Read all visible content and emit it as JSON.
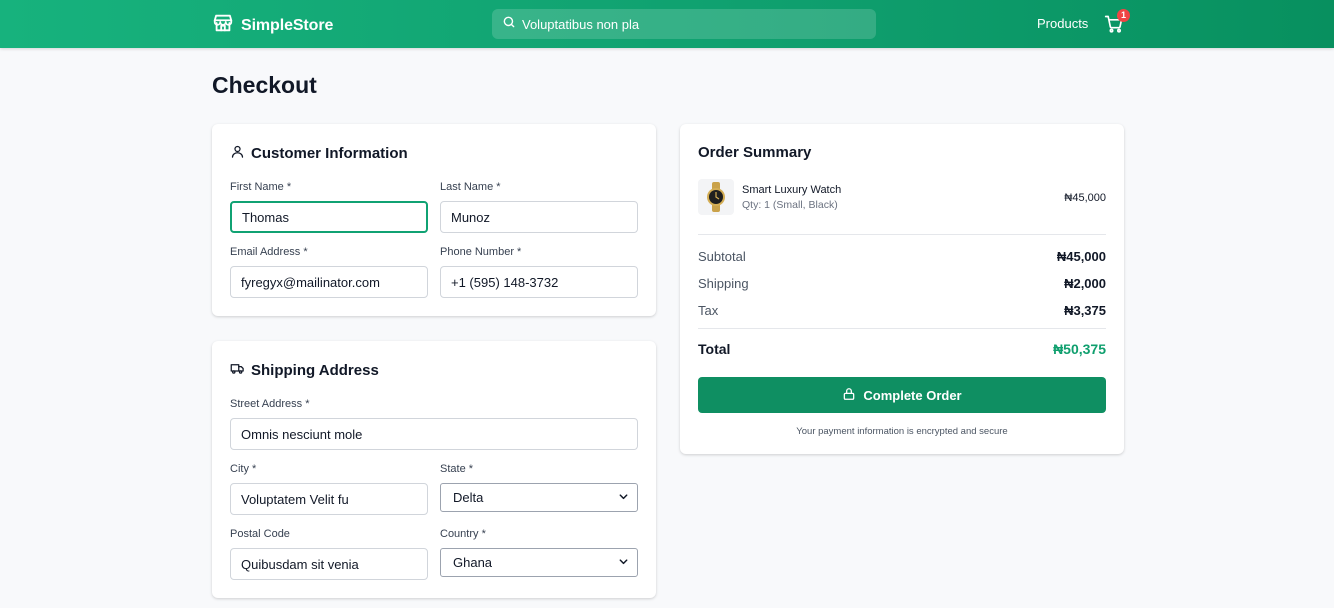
{
  "header": {
    "brand": "SimpleStore",
    "search_value": "Voluptatibus non pla",
    "nav_products": "Products",
    "cart_count": "1"
  },
  "page": {
    "title": "Checkout"
  },
  "customer": {
    "title": "Customer Information",
    "first_name_label": "First Name *",
    "first_name_value": "Thomas",
    "last_name_label": "Last Name *",
    "last_name_value": "Munoz",
    "email_label": "Email Address *",
    "email_value": "fyregyx@mailinator.com",
    "phone_label": "Phone Number *",
    "phone_value": "+1 (595) 148-3732"
  },
  "shipping": {
    "title": "Shipping Address",
    "street_label": "Street Address *",
    "street_value": "Omnis nesciunt mole",
    "city_label": "City *",
    "city_value": "Voluptatem Velit fu",
    "state_label": "State *",
    "state_value": "Delta",
    "postal_label": "Postal Code",
    "postal_value": "Quibusdam sit venia",
    "country_label": "Country *",
    "country_value": "Ghana"
  },
  "summary": {
    "title": "Order Summary",
    "item_name": "Smart Luxury Watch",
    "item_meta": "Qty: 1 (Small, Black)",
    "item_price": "₦45,000",
    "subtotal_label": "Subtotal",
    "subtotal_value": "₦45,000",
    "shipping_label": "Shipping",
    "shipping_value": "₦2,000",
    "tax_label": "Tax",
    "tax_value": "₦3,375",
    "total_label": "Total",
    "total_value": "₦50,375",
    "button_label": "Complete Order",
    "secure_note": "Your payment information is encrypted and secure"
  },
  "colors": {
    "brand": "#0f9f6e",
    "button": "#0f8f62",
    "total": "#0f9f6e",
    "badge": "#ef4444"
  },
  "icons": [
    "store-icon",
    "search-icon",
    "cart-icon",
    "user-icon",
    "truck-icon",
    "lock-icon",
    "chevron-down-icon"
  ]
}
